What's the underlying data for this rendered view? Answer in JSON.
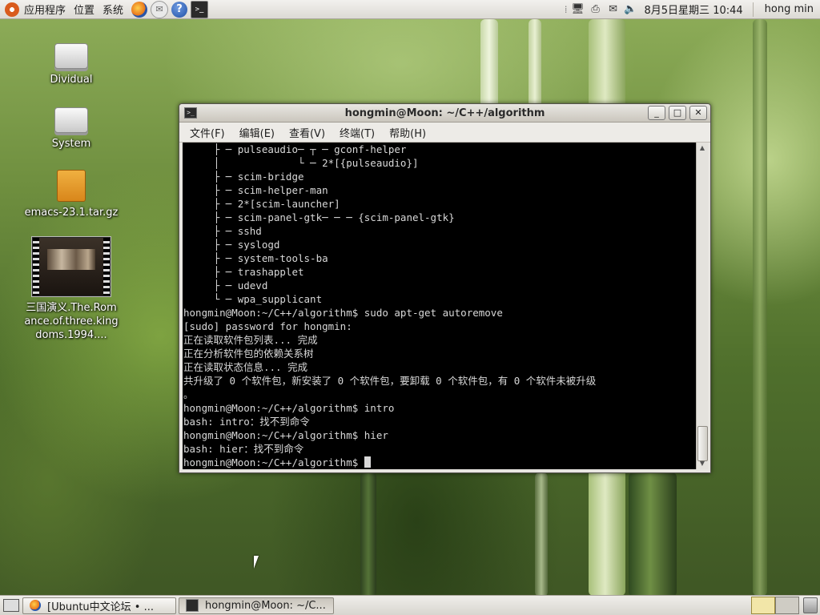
{
  "top_panel": {
    "menus": [
      "应用程序",
      "位置",
      "系统"
    ],
    "clock": "8月5日星期三 10:44",
    "username": "hong min",
    "launchers": [
      "firefox-icon",
      "mail-icon",
      "help-icon",
      "terminal-icon"
    ],
    "tray_icons": [
      "network-icon",
      "printer-icon",
      "mail-notify-icon",
      "volume-icon"
    ]
  },
  "desktop": {
    "icons": [
      {
        "label": "Dividual",
        "kind": "drive"
      },
      {
        "label": "System",
        "kind": "drive"
      },
      {
        "label": "emacs-23.1.tar.gz",
        "kind": "archive"
      },
      {
        "label": "三国演义.The.Romance.of.three.kingdoms.1994....",
        "kind": "video"
      }
    ]
  },
  "terminal": {
    "title": "hongmin@Moon: ~/C++/algorithm",
    "menus": [
      "文件(F)",
      "编辑(E)",
      "查看(V)",
      "终端(T)",
      "帮助(H)"
    ],
    "buttons": {
      "minimize": "_",
      "maximize": "□",
      "close": "✕"
    },
    "lines": [
      "     ├ ─ pulseaudio─ ┬ ─ gconf-helper",
      "     │             └ ─ 2*[{pulseaudio}]",
      "     ├ ─ scim-bridge",
      "     ├ ─ scim-helper-man",
      "     ├ ─ 2*[scim-launcher]",
      "     ├ ─ scim-panel-gtk─ ─ ─ {scim-panel-gtk}",
      "     ├ ─ sshd",
      "     ├ ─ syslogd",
      "     ├ ─ system-tools-ba",
      "     ├ ─ trashapplet",
      "     ├ ─ udevd",
      "     └ ─ wpa_supplicant",
      "hongmin@Moon:~/C++/algorithm$ sudo apt-get autoremove",
      "[sudo] password for hongmin:",
      "正在读取软件包列表... 完成",
      "正在分析软件包的依赖关系树",
      "正在读取状态信息... 完成",
      "共升级了 0 个软件包，新安装了 0 个软件包，要卸载 0 个软件包，有 0 个软件未被升级",
      "。",
      "hongmin@Moon:~/C++/algorithm$ intro",
      "bash: intro：找不到命令",
      "hongmin@Moon:~/C++/algorithm$ hier",
      "bash: hier：找不到命令"
    ],
    "prompt": "hongmin@Moon:~/C++/algorithm$ "
  },
  "taskbar": {
    "tasks": [
      {
        "label": "[Ubuntu中文论坛 • ...",
        "active": false
      },
      {
        "label": "hongmin@Moon: ~/C...",
        "active": true
      }
    ]
  }
}
